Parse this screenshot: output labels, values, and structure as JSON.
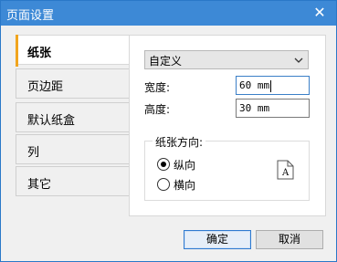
{
  "window": {
    "title": "页面设置",
    "close_icon": "close-icon"
  },
  "tabs": [
    {
      "label": "纸张",
      "active": true
    },
    {
      "label": "页边距",
      "active": false
    },
    {
      "label": "默认纸盒",
      "active": false
    },
    {
      "label": "列",
      "active": false
    },
    {
      "label": "其它",
      "active": false
    }
  ],
  "paper": {
    "size_selected": "自定义",
    "width_label": "宽度:",
    "width_value": "60 mm",
    "height_label": "高度:",
    "height_value": "30 mm",
    "orientation_label": "纸张方向:",
    "portrait_label": "纵向",
    "landscape_label": "横向",
    "portrait_selected": true,
    "preview_letter": "A"
  },
  "buttons": {
    "ok_label": "确定",
    "cancel_label": "取消"
  },
  "colors": {
    "titlebar": "#3d89d6",
    "tab_accent": "#f1a51e",
    "focus_border": "#3b7fc7"
  }
}
